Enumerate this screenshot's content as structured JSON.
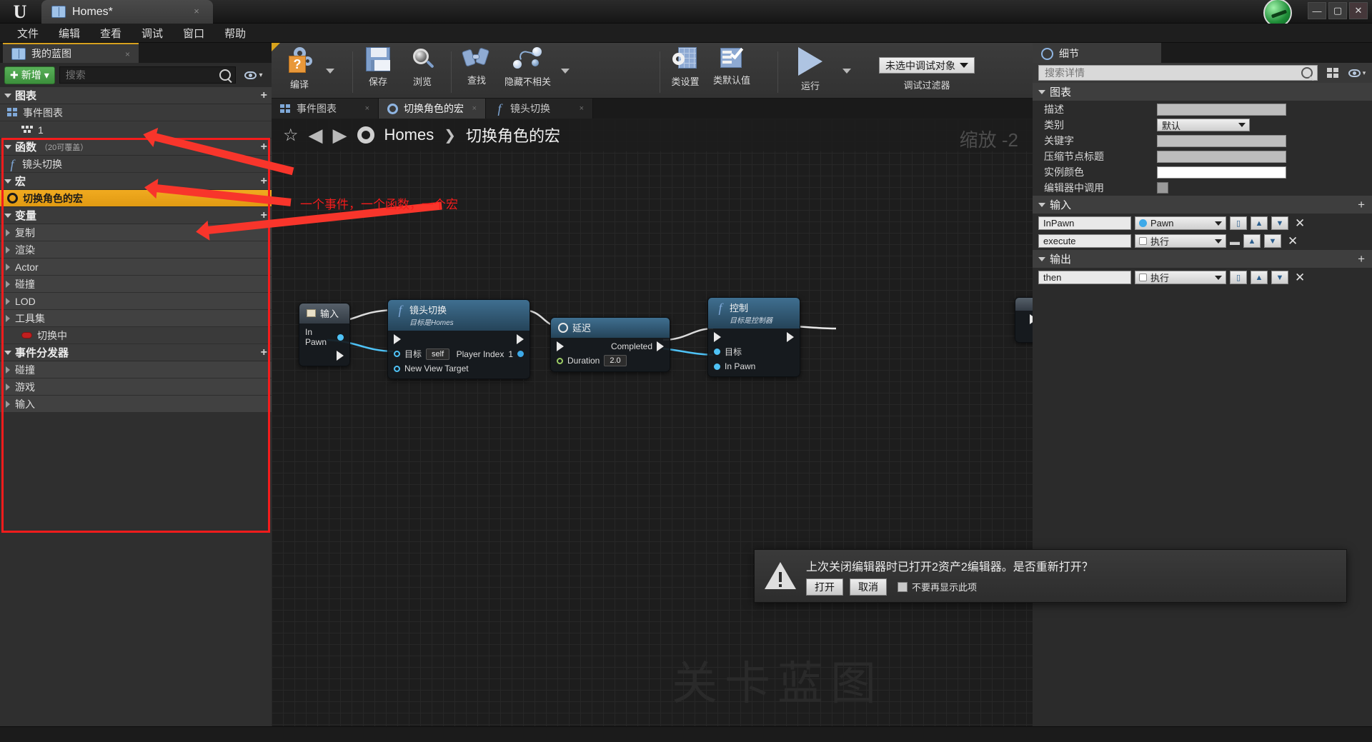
{
  "window": {
    "app_tab_title": "Homes*",
    "tab_close": "×",
    "minimize": "—",
    "maximize": "▢",
    "close": "✕"
  },
  "menubar": {
    "items": [
      "文件",
      "编辑",
      "查看",
      "调试",
      "窗口",
      "帮助"
    ]
  },
  "left_panel": {
    "tab_label": "我的蓝图",
    "tab_close": "×",
    "add_button": "新增",
    "add_caret": "▾",
    "search_placeholder": "搜索",
    "search_value": "",
    "eye_caret": "▾",
    "sections": [
      {
        "label": "图表",
        "sub": "",
        "plus": "+",
        "rows": [
          {
            "label": "事件图表",
            "icon": "graph-icon",
            "kind": "sub",
            "selected": false
          },
          {
            "label": "1",
            "icon": "grid-icon",
            "kind": "child",
            "selected": false
          }
        ]
      },
      {
        "label": "函数",
        "sub": "（20可覆盖）",
        "plus": "+",
        "rows": [
          {
            "label": "镜头切换",
            "icon": "function-icon",
            "kind": "sub",
            "selected": false
          }
        ]
      },
      {
        "label": "宏",
        "sub": "",
        "plus": "+",
        "rows": [
          {
            "label": "切换角色的宏",
            "icon": "gear-icon",
            "kind": "sub",
            "selected": true
          }
        ]
      },
      {
        "label": "变量",
        "sub": "",
        "plus": "+",
        "rows": [
          {
            "label": "复制",
            "icon": "expand-icon",
            "kind": "cat",
            "selected": false
          },
          {
            "label": "渲染",
            "icon": "expand-icon",
            "kind": "cat",
            "selected": false
          },
          {
            "label": "Actor",
            "icon": "expand-icon",
            "kind": "cat",
            "selected": false
          },
          {
            "label": "碰撞",
            "icon": "expand-icon",
            "kind": "cat",
            "selected": false
          },
          {
            "label": "LOD",
            "icon": "expand-icon",
            "kind": "cat",
            "selected": false
          },
          {
            "label": "工具集",
            "icon": "expand-icon",
            "kind": "cat",
            "selected": false
          },
          {
            "label": "切换中",
            "icon": "bool-pill-icon",
            "kind": "child",
            "selected": false
          }
        ]
      },
      {
        "label": "事件分发器",
        "sub": "",
        "plus": "+",
        "rows": [
          {
            "label": "碰撞",
            "icon": "expand-icon",
            "kind": "cat",
            "selected": false
          },
          {
            "label": "游戏",
            "icon": "expand-icon",
            "kind": "cat",
            "selected": false
          },
          {
            "label": "输入",
            "icon": "expand-icon",
            "kind": "cat",
            "selected": false
          }
        ]
      }
    ]
  },
  "annotation": {
    "text": "一个事件，一个函数，一个宏",
    "color": "#f41c1c"
  },
  "toolbar": {
    "buttons": [
      {
        "label": "编译",
        "icon": "compile-icon",
        "has_caret": true
      },
      {
        "label": "保存",
        "icon": "save-icon",
        "has_caret": false
      },
      {
        "label": "浏览",
        "icon": "browse-icon",
        "has_caret": false
      },
      {
        "label": "查找",
        "icon": "find-icon",
        "has_caret": false
      },
      {
        "label": "隐藏不相关",
        "icon": "hide-unrelated-icon",
        "has_caret": true
      },
      {
        "label": "类设置",
        "icon": "class-settings-icon",
        "has_caret": false
      },
      {
        "label": "类默认值",
        "icon": "class-defaults-icon",
        "has_caret": false
      },
      {
        "label": "运行",
        "icon": "play-icon",
        "has_caret": true
      }
    ],
    "debug_object": "未选中调试对象",
    "debug_caret": "▾",
    "debug_filter_label": "调试过滤器"
  },
  "graph_tabs": [
    {
      "label": "事件图表",
      "icon": "graph-icon",
      "active": false,
      "close": "×"
    },
    {
      "label": "切换角色的宏",
      "icon": "gear-icon",
      "active": true,
      "close": "×"
    },
    {
      "label": "镜头切换",
      "icon": "function-icon",
      "active": false,
      "close": "×"
    }
  ],
  "breadcrumb": {
    "star": "☆",
    "back": "◀",
    "forward": "▶",
    "gear": "gear-icon",
    "root": "Homes",
    "separator": "❯",
    "current": "切换角色的宏"
  },
  "canvas": {
    "zoom_label": "缩放 -2",
    "watermark": "关卡蓝图"
  },
  "nodes": [
    {
      "title": "输入",
      "subtitle": "",
      "header_style": "grey",
      "icon": "input-icon",
      "pins": [
        {
          "label": "In Pawn",
          "type": "data",
          "side": "out"
        },
        {
          "label": "",
          "type": "exec",
          "side": "out"
        }
      ]
    },
    {
      "title": "镜头切换",
      "subtitle": "目标是Homes",
      "header_style": "blue",
      "icon": "function-icon",
      "pins": [
        {
          "label": "目标",
          "value": "self",
          "type": "object",
          "side": "in"
        },
        {
          "label": "New View Target",
          "type": "object",
          "side": "in"
        },
        {
          "label": "Player Index",
          "value": "1",
          "type": "int",
          "side": "in"
        }
      ]
    },
    {
      "title": "延迟",
      "subtitle": "",
      "header_style": "blue",
      "icon": "clock-icon",
      "pins": [
        {
          "label": "Duration",
          "value": "2.0",
          "type": "float",
          "side": "in"
        },
        {
          "label": "Completed",
          "type": "exec",
          "side": "out"
        }
      ]
    },
    {
      "title": "控制",
      "subtitle": "目标是控制器",
      "header_style": "blue",
      "icon": "function-icon",
      "pins": [
        {
          "label": "目标",
          "type": "object",
          "side": "in"
        },
        {
          "label": "In Pawn",
          "type": "object",
          "side": "in"
        }
      ]
    }
  ],
  "details_panel": {
    "tab_label": "细节",
    "tab_icon": "details-icon",
    "search_placeholder": "搜索详情",
    "search_value": "",
    "grid_icon": "grid-view-icon",
    "eye_icon": "eye-icon",
    "eye_caret": "▾",
    "sections": [
      {
        "label": "图表",
        "plus": "",
        "properties": [
          {
            "name": "描述",
            "control": "text",
            "value": ""
          },
          {
            "name": "类别",
            "control": "combo",
            "value": "默认"
          },
          {
            "name": "关键字",
            "control": "text",
            "value": ""
          },
          {
            "name": "压缩节点标题",
            "control": "text",
            "value": ""
          },
          {
            "name": "实例颜色",
            "control": "color",
            "value": ""
          },
          {
            "name": "编辑器中调用",
            "control": "checkbox",
            "value": ""
          }
        ]
      },
      {
        "label": "输入",
        "plus": "+",
        "params": [
          {
            "name": "InPawn",
            "type": "Pawn",
            "dot": "object",
            "up": "▲",
            "down": "▼",
            "del": "✕",
            "has_eq": false
          },
          {
            "name": "execute",
            "type": "执行",
            "dot": "exec",
            "up": "▲",
            "down": "▼",
            "del": "✕",
            "has_eq": true
          }
        ]
      },
      {
        "label": "输出",
        "plus": "+",
        "params": [
          {
            "name": "then",
            "type": "执行",
            "dot": "exec",
            "up": "▲",
            "down": "▼",
            "del": "✕",
            "has_eq": false
          }
        ]
      }
    ]
  },
  "dialog": {
    "icon": "warning-icon",
    "message": "上次关闭编辑器时已打开2资产2编辑器。是否重新打开？",
    "confirm": "打开",
    "cancel": "取消",
    "checkbox_label": "不要再显示此项"
  }
}
